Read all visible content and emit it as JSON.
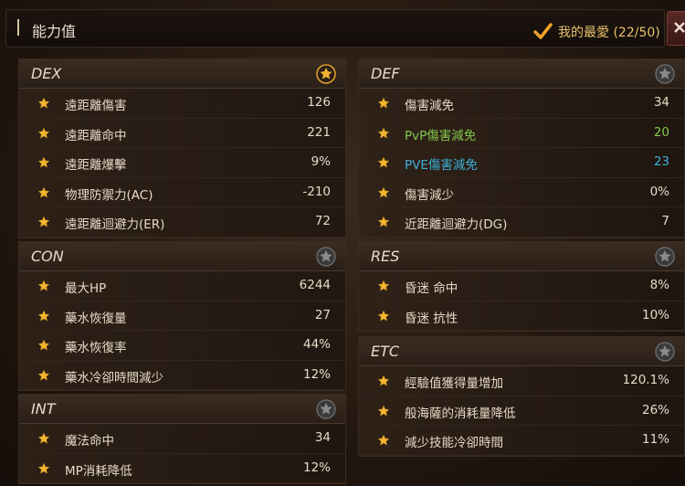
{
  "window": {
    "title": "能力值",
    "favorites_label": "我的最愛 (22/50)"
  },
  "panels": {
    "dex": {
      "name": "DEX",
      "favorited": true,
      "rows": [
        {
          "label": "遠距離傷害",
          "value": "126"
        },
        {
          "label": "遠距離命中",
          "value": "221"
        },
        {
          "label": "遠距離爆擊",
          "value": "9%"
        },
        {
          "label": "物理防禦力(AC)",
          "value": "-210"
        },
        {
          "label": "遠距離迴避力(ER)",
          "value": "72"
        }
      ]
    },
    "con": {
      "name": "CON",
      "favorited": false,
      "rows": [
        {
          "label": "最大HP",
          "value": "6244"
        },
        {
          "label": "藥水恢復量",
          "value": "27"
        },
        {
          "label": "藥水恢復率",
          "value": "44%"
        },
        {
          "label": "藥水冷卻時間減少",
          "value": "12%"
        }
      ]
    },
    "int": {
      "name": "INT",
      "favorited": false,
      "rows": [
        {
          "label": "魔法命中",
          "value": "34"
        },
        {
          "label": "MP消耗降低",
          "value": "12%"
        }
      ]
    },
    "def": {
      "name": "DEF",
      "favorited": false,
      "rows": [
        {
          "label": "傷害減免",
          "value": "34"
        },
        {
          "label": "PvP傷害減免",
          "value": "20",
          "color": "#86c84a"
        },
        {
          "label": "PVE傷害減免",
          "value": "23",
          "color": "#3fb0d8"
        },
        {
          "label": "傷害減少",
          "value": "0%"
        },
        {
          "label": "近距離迴避力(DG)",
          "value": "7"
        }
      ]
    },
    "res": {
      "name": "RES",
      "favorited": false,
      "rows": [
        {
          "label": "昏迷 命中",
          "value": "8%"
        },
        {
          "label": "昏迷 抗性",
          "value": "10%"
        }
      ]
    },
    "etc": {
      "name": "ETC",
      "favorited": false,
      "rows": [
        {
          "label": "經驗值獲得量增加",
          "value": "120.1%"
        },
        {
          "label": "般海薩的消耗量降低",
          "value": "26%"
        },
        {
          "label": "減少技能冷卻時間",
          "value": "11%"
        }
      ]
    }
  },
  "colors": {
    "star": "#f2b531",
    "accent": "#e7c26a"
  }
}
